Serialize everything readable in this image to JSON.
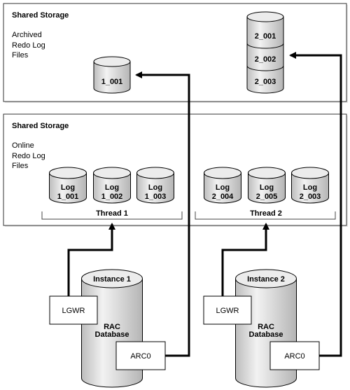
{
  "archived_storage": {
    "title": "Shared Storage",
    "label_lines": [
      "Archived",
      "Redo Log",
      "Files"
    ],
    "thread1_archives": [
      "1_001"
    ],
    "thread2_archives": [
      "2_001",
      "2_002",
      "2_003"
    ]
  },
  "online_storage": {
    "title": "Shared Storage",
    "label_lines": [
      "Online",
      "Redo Log",
      "Files"
    ],
    "threads": [
      {
        "label": "Thread 1",
        "logs": [
          [
            "Log",
            "1_001"
          ],
          [
            "Log",
            "1_002"
          ],
          [
            "Log",
            "1_003"
          ]
        ]
      },
      {
        "label": "Thread 2",
        "logs": [
          [
            "Log",
            "2_004"
          ],
          [
            "Log",
            "2_005"
          ],
          [
            "Log",
            "2_003"
          ]
        ]
      }
    ]
  },
  "instances": [
    {
      "name": "Instance 1",
      "db_lines": [
        "RAC",
        "Database"
      ],
      "writer": "LGWR",
      "archiver": "ARC0"
    },
    {
      "name": "Instance 2",
      "db_lines": [
        "RAC",
        "Database"
      ],
      "writer": "LGWR",
      "archiver": "ARC0"
    }
  ],
  "colors": {
    "cylinder_light": "#f4f4f4",
    "cylinder_dark": "#b8b8b8",
    "line": "#000000"
  }
}
